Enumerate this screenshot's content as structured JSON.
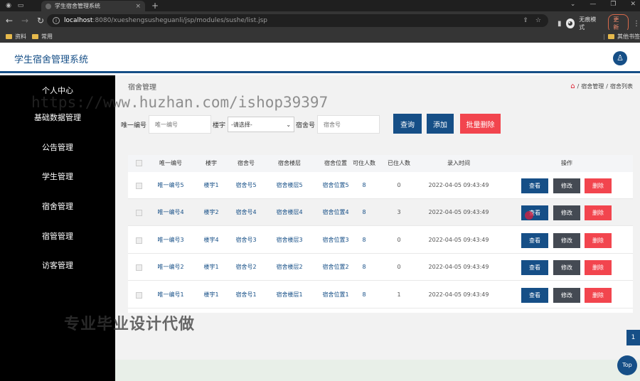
{
  "browser": {
    "tab_title": "学生宿舍管理系统",
    "url_host": "localhost",
    "url_path": ":8080/xueshengsusheguanli/jsp/modules/sushe/list.jsp",
    "incognito_label": "无痕模式",
    "update_label": "更新",
    "bookmarks": [
      "资料",
      "常用"
    ],
    "bookmarks_right": "其他书签"
  },
  "app": {
    "title": "学生宿舍管理系统"
  },
  "sidebar": {
    "items": [
      {
        "label": "个人中心"
      },
      {
        "label": "基础数据管理"
      },
      {
        "label": "公告管理"
      },
      {
        "label": "学生管理"
      },
      {
        "label": "宿舍管理"
      },
      {
        "label": "宿管管理"
      },
      {
        "label": "访客管理"
      }
    ]
  },
  "breadcrumb": {
    "title": "宿舍管理",
    "home_sep": "/",
    "crumb1": "宿舍管理",
    "sep": "/",
    "crumb2": "宿舍列表"
  },
  "filters": {
    "code_label": "唯一编号",
    "code_placeholder": "唯一编号",
    "building_label": "楼宇",
    "building_selected": "-请选择-",
    "room_label": "宿舍号",
    "room_placeholder": "宿舍号",
    "query_btn": "查询",
    "add_btn": "添加",
    "batch_delete_btn": "批量删除"
  },
  "table": {
    "columns": [
      "唯一编号",
      "楼宇",
      "宿舍号",
      "宿舍楼层",
      "宿舍位置",
      "可住人数",
      "已住人数",
      "录入时间",
      "操作"
    ],
    "rows": [
      {
        "code": "唯一编号5",
        "building": "楼宇1",
        "room": "宿舍号5",
        "floor": "宿舍楼层5",
        "location": "宿舍位置5",
        "capacity": "8",
        "occupied": "0",
        "time": "2022-04-05 09:43:49"
      },
      {
        "code": "唯一编号4",
        "building": "楼宇2",
        "room": "宿舍号4",
        "floor": "宿舍楼层4",
        "location": "宿舍位置4",
        "capacity": "8",
        "occupied": "3",
        "time": "2022-04-05 09:43:49"
      },
      {
        "code": "唯一编号3",
        "building": "楼宇4",
        "room": "宿舍号3",
        "floor": "宿舍楼层3",
        "location": "宿舍位置3",
        "capacity": "8",
        "occupied": "0",
        "time": "2022-04-05 09:43:49"
      },
      {
        "code": "唯一编号2",
        "building": "楼宇1",
        "room": "宿舍号2",
        "floor": "宿舍楼层2",
        "location": "宿舍位置2",
        "capacity": "8",
        "occupied": "0",
        "time": "2022-04-05 09:43:49"
      },
      {
        "code": "唯一编号1",
        "building": "楼宇1",
        "room": "宿舍号1",
        "floor": "宿舍楼层1",
        "location": "宿舍位置1",
        "capacity": "8",
        "occupied": "1",
        "time": "2022-04-05 09:43:49"
      }
    ],
    "view_label": "查看",
    "edit_label": "修改",
    "delete_label": "删除"
  },
  "pagination": {
    "current_page": "1"
  },
  "top_button": "Top",
  "overlays": {
    "url_watermark": "https://www.huzhan.com/ishop39397",
    "cn_watermark": "专业毕业设计代做"
  },
  "colors": {
    "primary": "#164f87",
    "danger": "#f2454e",
    "dark_button": "#444a53",
    "sidebar_bg": "#000000"
  }
}
